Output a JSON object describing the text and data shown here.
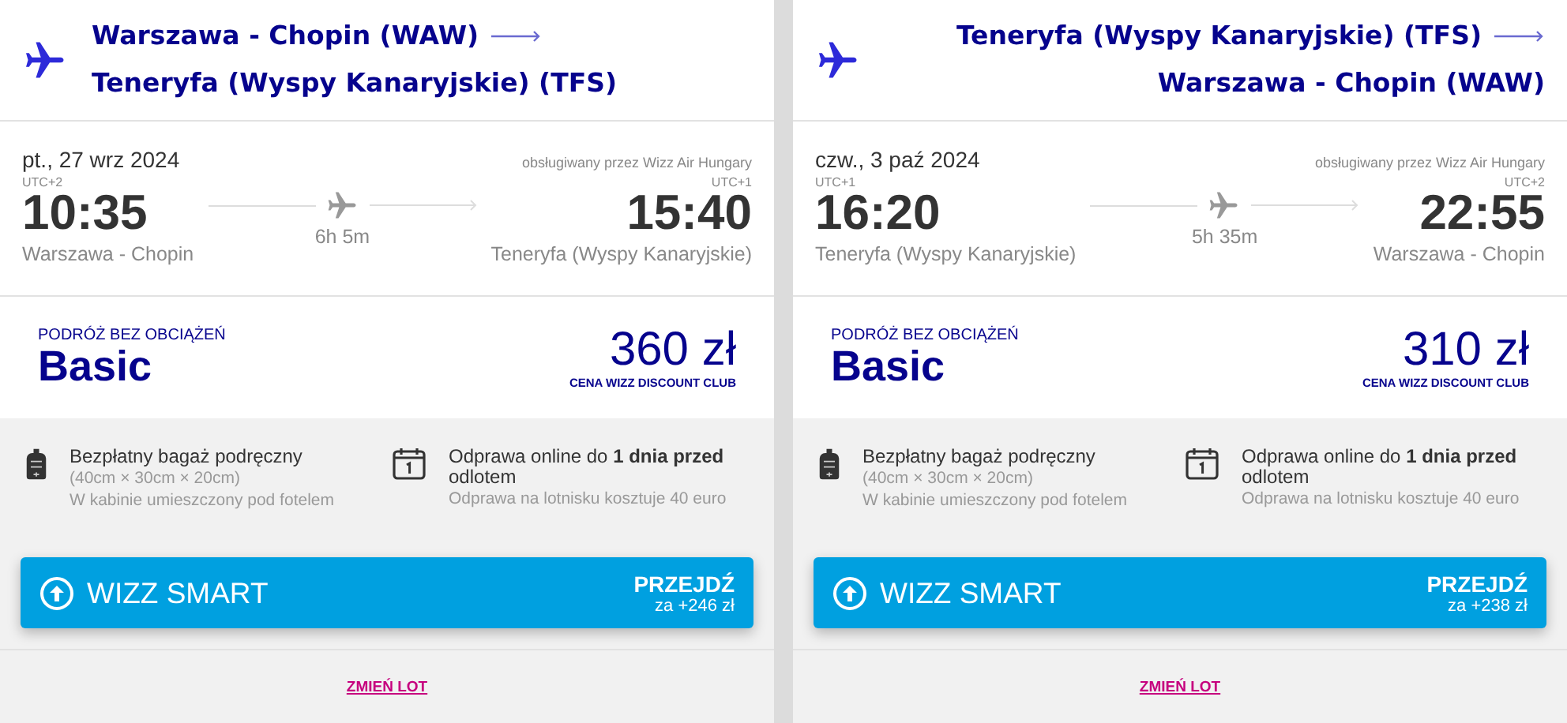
{
  "flights": [
    {
      "kind": "outbound",
      "origin": "Warszawa - Chopin (WAW)",
      "destination": "Teneryfa (Wyspy Kanaryjskie) (TFS)",
      "date": "pt., 27 wrz 2024",
      "operator": "obsługiwany przez Wizz Air Hungary",
      "departure": {
        "utc": "UTC+2",
        "time": "10:35",
        "airport": "Warszawa - Chopin"
      },
      "duration": "6h 5m",
      "arrival": {
        "utc": "UTC+1",
        "time": "15:40",
        "airport": "Teneryfa (Wyspy Kanaryjskie)"
      },
      "fare": {
        "label": "PODRÓŻ BEZ OBCIĄŻEŃ",
        "name": "Basic",
        "price": "360 zł",
        "price_note": "CENA WIZZ DISCOUNT CLUB"
      },
      "features": [
        {
          "kind": "baggage",
          "title": "Bezpłatny bagaż podręczny",
          "details": [
            "(40cm × 30cm × 20cm)",
            "W kabinie umieszczony pod fotelem"
          ]
        },
        {
          "kind": "checkin",
          "title": "Odprawa online do **1 dnia przed** odlotem",
          "details": [
            "Odprawa na lotnisku kosztuje 40 euro"
          ]
        }
      ],
      "upgrade": {
        "name": "WIZZ SMART",
        "action": "PRZEJDŹ",
        "price": "za +246 zł"
      },
      "link": "ZMIEŃ LOT"
    },
    {
      "kind": "return",
      "origin": "Teneryfa (Wyspy Kanaryjskie) (TFS)",
      "destination": "Warszawa - Chopin (WAW)",
      "date": "czw., 3 paź 2024",
      "operator": "obsługiwany przez Wizz Air Hungary",
      "departure": {
        "utc": "UTC+1",
        "time": "16:20",
        "airport": "Teneryfa (Wyspy Kanaryjskie)"
      },
      "duration": "5h 35m",
      "arrival": {
        "utc": "UTC+2",
        "time": "22:55",
        "airport": "Warszawa - Chopin"
      },
      "fare": {
        "label": "PODRÓŻ BEZ OBCIĄŻEŃ",
        "name": "Basic",
        "price": "310 zł",
        "price_note": "CENA WIZZ DISCOUNT CLUB"
      },
      "features": [
        {
          "kind": "baggage",
          "title": "Bezpłatny bagaż podręczny",
          "details": [
            "(40cm × 30cm × 20cm)",
            "W kabinie umieszczony pod fotelem"
          ]
        },
        {
          "kind": "checkin",
          "title": "Odprawa online do **1 dnia przed** odlotem",
          "details": [
            "Odprawa na lotnisku kosztuje 40 euro"
          ]
        }
      ],
      "upgrade": {
        "name": "WIZZ SMART",
        "action": "PRZEJDŹ",
        "price": "za +238 zł"
      },
      "link": "ZMIEŃ LOT"
    }
  ]
}
